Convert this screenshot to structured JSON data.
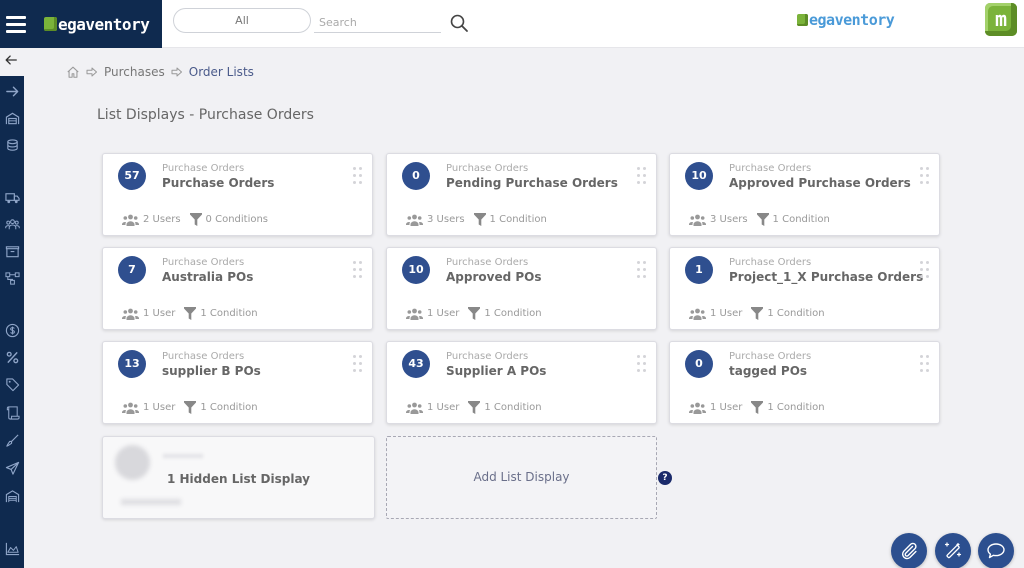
{
  "header": {
    "brand_name": "egaventory",
    "brand_initial": "m",
    "right_brand_name": "egaventory",
    "right_brand_initial": "m",
    "app_cube_letter": "m",
    "scope_select_value": "All",
    "search_placeholder": "Search",
    "search_value": ""
  },
  "breadcrumb": {
    "items": [
      {
        "label": "Purchases"
      },
      {
        "label": "Order Lists"
      }
    ]
  },
  "page": {
    "title": "List Displays - Purchase Orders"
  },
  "cards": [
    {
      "count": "57",
      "category": "Purchase Orders",
      "title": "Purchase Orders",
      "users": "2 Users",
      "conditions": "0 Conditions"
    },
    {
      "count": "0",
      "category": "Purchase Orders",
      "title": "Pending Purchase Orders",
      "users": "3 Users",
      "conditions": "1 Condition"
    },
    {
      "count": "10",
      "category": "Purchase Orders",
      "title": "Approved Purchase Orders",
      "users": "3 Users",
      "conditions": "1 Condition"
    },
    {
      "count": "7",
      "category": "Purchase Orders",
      "title": "Australia POs",
      "users": "1 User",
      "conditions": "1 Condition"
    },
    {
      "count": "10",
      "category": "Purchase Orders",
      "title": "Approved POs",
      "users": "1 User",
      "conditions": "1 Condition"
    },
    {
      "count": "1",
      "category": "Purchase Orders",
      "title": "Project_1_X Purchase Orders",
      "users": "1 User",
      "conditions": "1 Condition"
    },
    {
      "count": "13",
      "category": "Purchase Orders",
      "title": "supplier B POs",
      "users": "1 User",
      "conditions": "1 Condition"
    },
    {
      "count": "43",
      "category": "Purchase Orders",
      "title": "Supplier A POs",
      "users": "1 User",
      "conditions": "1 Condition"
    },
    {
      "count": "0",
      "category": "Purchase Orders",
      "title": "tagged POs",
      "users": "1 User",
      "conditions": "1 Condition"
    }
  ],
  "hidden_card": {
    "label": "1 Hidden List Display"
  },
  "add_card": {
    "label": "Add List Display"
  },
  "help": {
    "glyph": "?"
  },
  "sidebar": {
    "icons": [
      "arrow-right-icon",
      "warehouse-icon",
      "layers-icon",
      "truck-icon",
      "users-icon",
      "box-icon",
      "workflow-icon",
      "dollar-icon",
      "percent-icon",
      "tag-icon",
      "scroll-icon",
      "brush-icon",
      "send-icon",
      "garage-icon",
      "chart-icon"
    ]
  },
  "fabs": [
    {
      "name": "attachment"
    },
    {
      "name": "magic-wand"
    },
    {
      "name": "chat"
    }
  ],
  "colors": {
    "nav_dark": "#0f2a4f",
    "badge_blue": "#2f4f8f",
    "brand_green": "#7bb33a",
    "brand_blue": "#4a9ad8"
  }
}
